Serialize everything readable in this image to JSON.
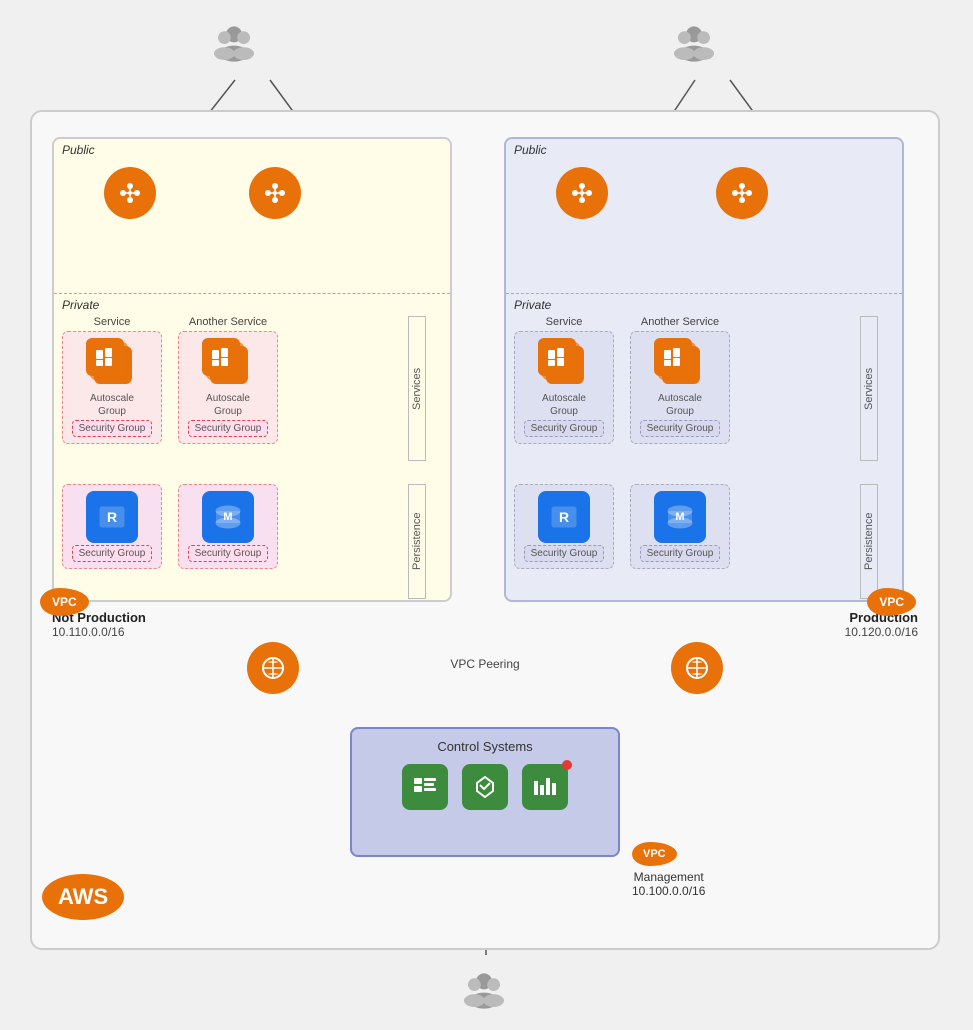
{
  "users": {
    "top_left_label": "",
    "top_right_label": "",
    "bottom_label": ""
  },
  "vpc_left": {
    "name": "Not Production",
    "cidr": "10.110.0.0/16",
    "public_label": "Public",
    "private_label": "Private",
    "services_label": "Services",
    "persistence_label": "Persistence",
    "service1": {
      "title": "Service",
      "autoscale_label": "Autoscale\nGroup",
      "security_group": "Security Group"
    },
    "service2": {
      "title": "Another Service",
      "autoscale_label": "Autoscale\nGroup",
      "security_group": "Security Group"
    },
    "persistence1": {
      "security_group": "Security Group"
    },
    "persistence2": {
      "security_group": "Security Group"
    }
  },
  "vpc_right": {
    "name": "Production",
    "cidr": "10.120.0.0/16",
    "public_label": "Public",
    "private_label": "Private",
    "services_label": "Services",
    "persistence_label": "Persistence",
    "service1": {
      "title": "Service",
      "autoscale_label": "Autoscale\nGroup",
      "security_group": "Security Group"
    },
    "service2": {
      "title": "Another Service",
      "autoscale_label": "Autoscale\nGroup",
      "security_group": "Security Group"
    },
    "persistence1": {
      "security_group": "Security Group"
    },
    "persistence2": {
      "security_group": "Security Group"
    }
  },
  "vpc_management": {
    "name": "Management",
    "cidr": "10.100.0.0/16"
  },
  "peering": {
    "label": "VPC Peering"
  },
  "control_systems": {
    "title": "Control Systems"
  },
  "aws_badge": "AWS"
}
